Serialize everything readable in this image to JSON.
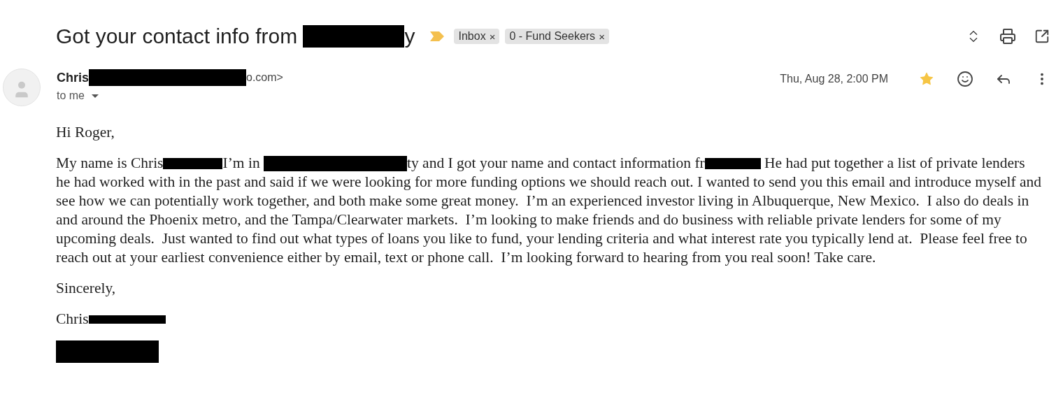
{
  "subject": {
    "parts": [
      {
        "kind": "text",
        "text": "Got your contact info from "
      },
      {
        "kind": "redacted"
      },
      {
        "kind": "text",
        "text": "y"
      }
    ],
    "important": true
  },
  "labels": [
    {
      "text": "Inbox",
      "remove": "×"
    },
    {
      "text": "0 - Fund Seekers",
      "remove": "×"
    }
  ],
  "sender": {
    "parts": [
      {
        "kind": "name",
        "text": "Chris"
      },
      {
        "kind": "redacted"
      },
      {
        "kind": "email",
        "text": "o.com>"
      }
    ],
    "recipient": "to me"
  },
  "date": "Thu, Aug 28, 2:00 PM",
  "starred": true,
  "body": [
    {
      "parts": [
        {
          "kind": "text",
          "text": "Hi Roger,"
        }
      ]
    },
    {
      "parts": [
        {
          "kind": "text",
          "text": "My name is Chris"
        },
        {
          "kind": "redacted"
        },
        {
          "kind": "text",
          "text": "I’m in "
        },
        {
          "kind": "redacted"
        },
        {
          "kind": "text",
          "text": "ty and I got your name and contact information fr"
        },
        {
          "kind": "redacted"
        },
        {
          "kind": "text",
          "text": " He had put together a list of private lenders"
        }
      ],
      "continued": "he had worked with in the past and said if we were looking for more funding options we should reach out. I wanted to send you this email and introduce myself and see how we can potentially work together, and both make some great money.  I’m an experienced investor living in Albuquerque, New Mexico.  I also do deals in and around the Phoenix metro, and the Tampa/Clearwater markets.  I’m looking to make friends and do business with reliable private lenders for some of my upcoming deals.  Just wanted to find out what types of loans you like to fund, your lending criteria and what interest rate you typically lend at.  Please feel free to reach out at your earliest convenience either by email, text or phone call.  I’m looking forward to hearing from you real soon! Take care."
    },
    {
      "parts": [
        {
          "kind": "text",
          "text": "Sincerely,"
        }
      ]
    },
    {
      "parts": [
        {
          "kind": "text",
          "text": "Chris"
        },
        {
          "kind": "redacted"
        }
      ]
    },
    {
      "parts": [
        {
          "kind": "redacted"
        }
      ]
    }
  ]
}
